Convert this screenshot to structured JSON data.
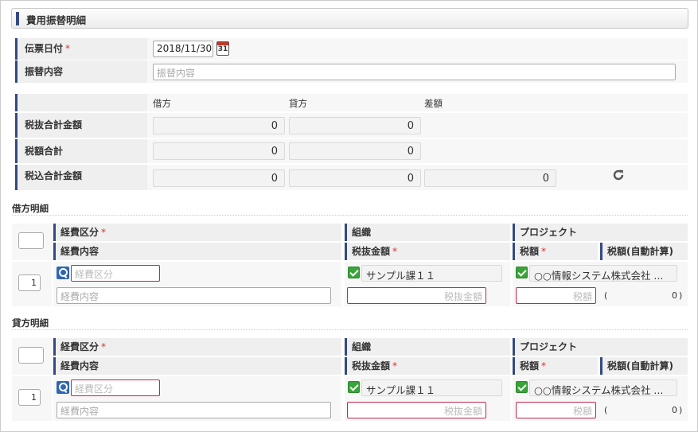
{
  "header": {
    "title": "費用振替明細"
  },
  "form": {
    "date_label": "伝票日付",
    "date_required": "*",
    "date_value": "2018/11/30",
    "calendar_day": "31",
    "content_label": "振替内容",
    "content_placeholder": "振替内容"
  },
  "totals": {
    "col_debit": "借方",
    "col_credit": "貸方",
    "col_diff": "差額",
    "rows": [
      {
        "label": "税抜合計金額",
        "debit": "0",
        "credit": "0"
      },
      {
        "label": "税額合計",
        "debit": "0",
        "credit": "0"
      },
      {
        "label": "税込合計金額",
        "debit": "0",
        "credit": "0",
        "diff": "0"
      }
    ]
  },
  "debit_section": {
    "title": "借方明細",
    "h_expense_type": "経費区分",
    "h_org": "組織",
    "h_project": "プロジェクト",
    "h_expense_content": "経費内容",
    "h_amount_ex_tax": "税抜金額",
    "h_tax": "税額",
    "h_tax_auto": "税額(自動計算)",
    "req": "*",
    "row": {
      "no": "1",
      "expense_type_placeholder": "経費区分",
      "org_value": "サンプル課１１",
      "project_value": "○○情報システム株式会社 ...",
      "content_placeholder": "経費内容",
      "amount_placeholder": "税抜金額",
      "tax_placeholder": "税額",
      "auto_open": "(",
      "auto_value": "0",
      "auto_close": ")"
    }
  },
  "credit_section": {
    "title": "貸方明細",
    "h_expense_type": "経費区分",
    "h_org": "組織",
    "h_project": "プロジェクト",
    "h_expense_content": "経費内容",
    "h_amount_ex_tax": "税抜金額",
    "h_tax": "税額",
    "h_tax_auto": "税額(自動計算)",
    "req": "*",
    "row": {
      "no": "1",
      "expense_type_placeholder": "経費区分",
      "org_value": "サンプル課１１",
      "project_value": "○○情報システム株式会社 ...",
      "content_placeholder": "経費内容",
      "amount_placeholder": "税抜金額",
      "tax_placeholder": "税額",
      "auto_open": "(",
      "auto_value": "0",
      "auto_close": ")"
    }
  },
  "colors": {
    "accent": "#334a82",
    "required": "#e03030",
    "check": "#3aa33a",
    "error_border": "#c0284a"
  },
  "icons": {
    "calendar": "calendar-icon",
    "refresh": "refresh-icon",
    "search": "search-icon",
    "check": "checkbox-checked-icon"
  }
}
